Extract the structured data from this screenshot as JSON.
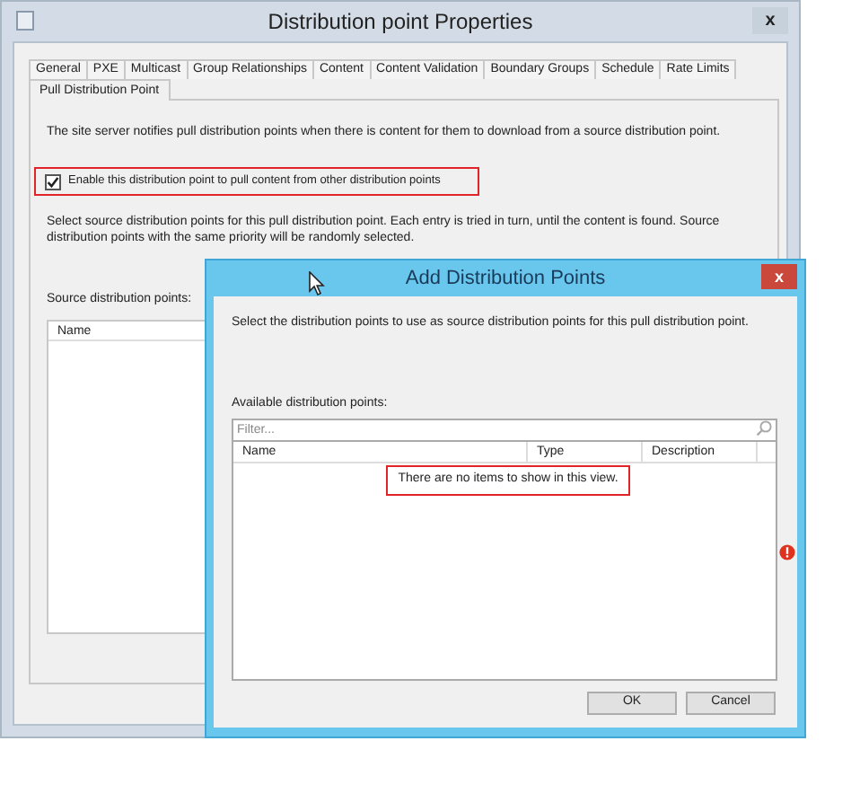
{
  "window": {
    "title": "Distribution point Properties",
    "close": "x"
  },
  "tab_rows": [
    [
      {
        "label": "General",
        "selected": false
      },
      {
        "label": "PXE",
        "selected": false
      },
      {
        "label": "Multicast",
        "selected": false
      },
      {
        "label": "Group Relationships",
        "selected": false
      },
      {
        "label": "Content",
        "selected": false
      },
      {
        "label": "Content Validation",
        "selected": false
      },
      {
        "label": "Boundary Groups",
        "selected": false
      },
      {
        "label": "Schedule",
        "selected": false
      },
      {
        "label": "Rate Limits",
        "selected": false
      }
    ],
    [
      {
        "label": "Pull Distribution Point",
        "selected": true
      }
    ]
  ],
  "panel": {
    "intro": "The site server notifies pull distribution points when there is content for them to download from a source distribution point.",
    "checkbox": {
      "label": "Enable this distribution point to pull content from other distribution points",
      "checked": true,
      "highlighted": true
    },
    "description": "Select source distribution points for this pull distribution point. Each entry is tried in turn, until the content is found. Source distribution points with the same priority will be randomly selected.",
    "source_label": "Source distribution points:",
    "source_list": {
      "columns": [
        "Name"
      ]
    }
  },
  "dialog": {
    "title": "Add Distribution Points",
    "close": "x",
    "instruction": "Select the distribution points to use as source distribution points for this pull distribution point.",
    "available_label": "Available distribution points:",
    "filter": {
      "placeholder": "Filter..."
    },
    "list": {
      "columns": [
        "Name",
        "Type",
        "Description"
      ],
      "empty_message": "There are no items to show in this view.",
      "empty_highlighted": true
    },
    "buttons": [
      "OK",
      "Cancel"
    ]
  }
}
